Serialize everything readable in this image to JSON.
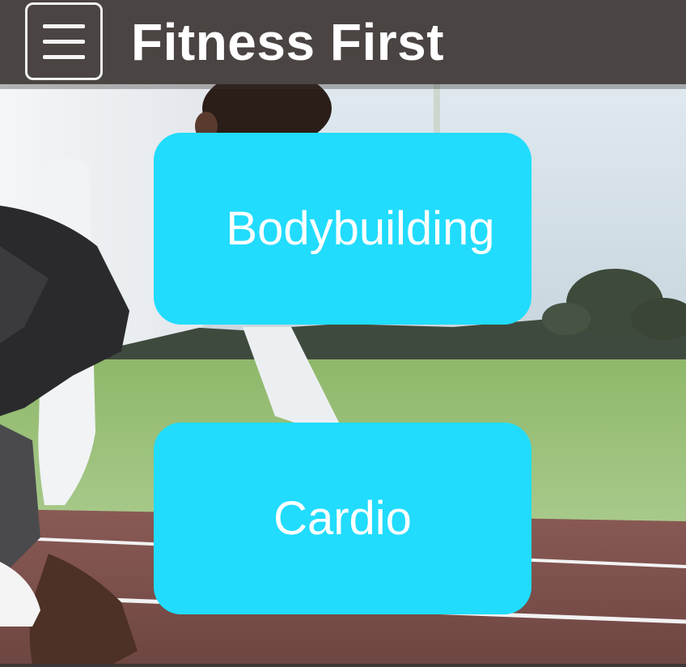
{
  "header": {
    "title": "Fitness First",
    "menu_icon": "hamburger-menu-icon",
    "background": "#4a4442"
  },
  "hero": {
    "image": "athlete-starting-blocks-track"
  },
  "categories": [
    {
      "label": "Bodybuilding",
      "color": "#21dcfd"
    },
    {
      "label": "Cardio",
      "color": "#21dcfd"
    }
  ]
}
